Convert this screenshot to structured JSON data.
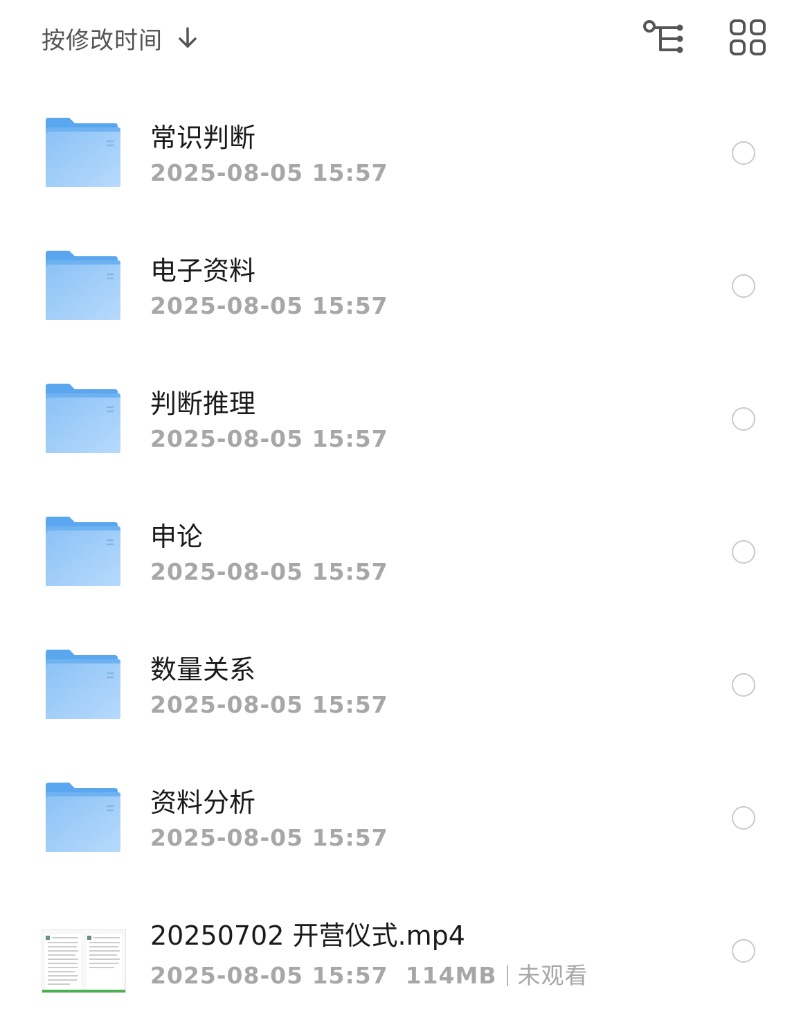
{
  "header": {
    "sort_label": "按修改时间",
    "sort_icon": "arrow-down-icon",
    "tree_view_icon": "tree-view-icon",
    "grid_view_icon": "grid-view-icon"
  },
  "colors": {
    "folder_back": "#5aa6ef",
    "folder_front": "#a9d2fa",
    "radio_border": "#c9c9c9",
    "meta_text": "#a7a7a7"
  },
  "items": [
    {
      "type": "folder",
      "icon": "folder-icon",
      "name": "常识判断",
      "date": "2025-08-05 15:57"
    },
    {
      "type": "folder",
      "icon": "folder-icon",
      "name": "电子资料",
      "date": "2025-08-05 15:57"
    },
    {
      "type": "folder",
      "icon": "folder-icon",
      "name": "判断推理",
      "date": "2025-08-05 15:57"
    },
    {
      "type": "folder",
      "icon": "folder-icon",
      "name": "申论",
      "date": "2025-08-05 15:57"
    },
    {
      "type": "folder",
      "icon": "folder-icon",
      "name": "数量关系",
      "date": "2025-08-05 15:57"
    },
    {
      "type": "folder",
      "icon": "folder-icon",
      "name": "资料分析",
      "date": "2025-08-05 15:57"
    },
    {
      "type": "video",
      "icon": "video-thumbnail",
      "name": "20250702 开营仪式.mp4",
      "date": "2025-08-05 15:57",
      "size": "114MB",
      "watch_status": "未观看"
    }
  ]
}
